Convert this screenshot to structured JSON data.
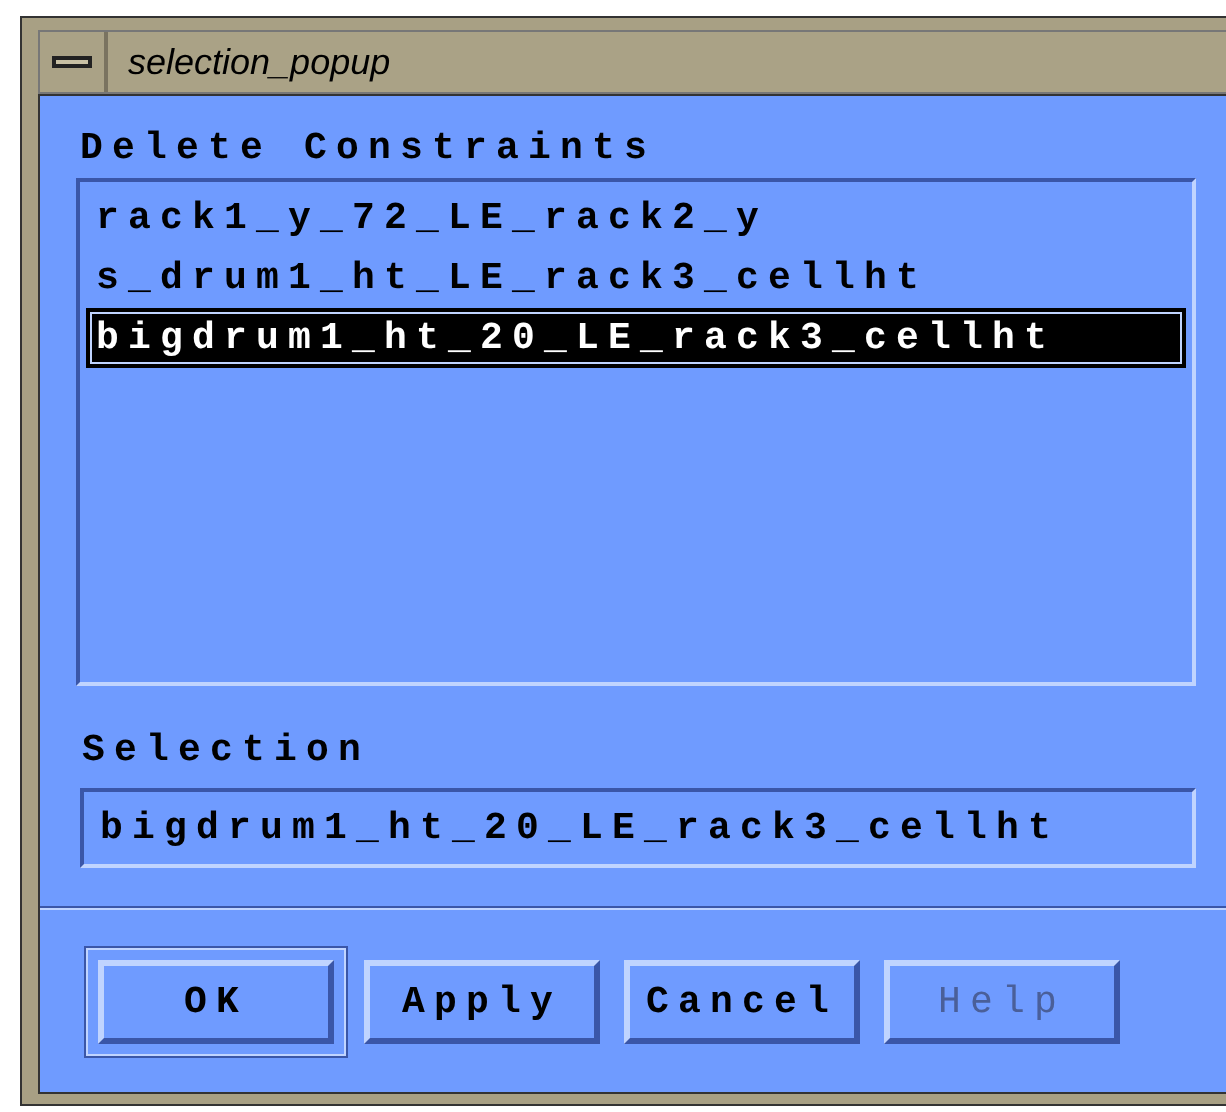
{
  "window": {
    "title": "selection_popup"
  },
  "list": {
    "label": "Delete Constraints",
    "items": [
      {
        "text": "rack1_y_72_LE_rack2_y",
        "selected": false
      },
      {
        "text": "s_drum1_ht_LE_rack3_cellht",
        "selected": false
      },
      {
        "text": "bigdrum1_ht_20_LE_rack3_cellht",
        "selected": true
      }
    ]
  },
  "selection": {
    "label": "Selection",
    "value": "bigdrum1_ht_20_LE_rack3_cellht"
  },
  "buttons": [
    {
      "label": "OK",
      "default": true,
      "disabled": false
    },
    {
      "label": "Apply",
      "default": false,
      "disabled": false
    },
    {
      "label": "Cancel",
      "default": false,
      "disabled": false
    },
    {
      "label": "Help",
      "default": false,
      "disabled": true
    }
  ]
}
